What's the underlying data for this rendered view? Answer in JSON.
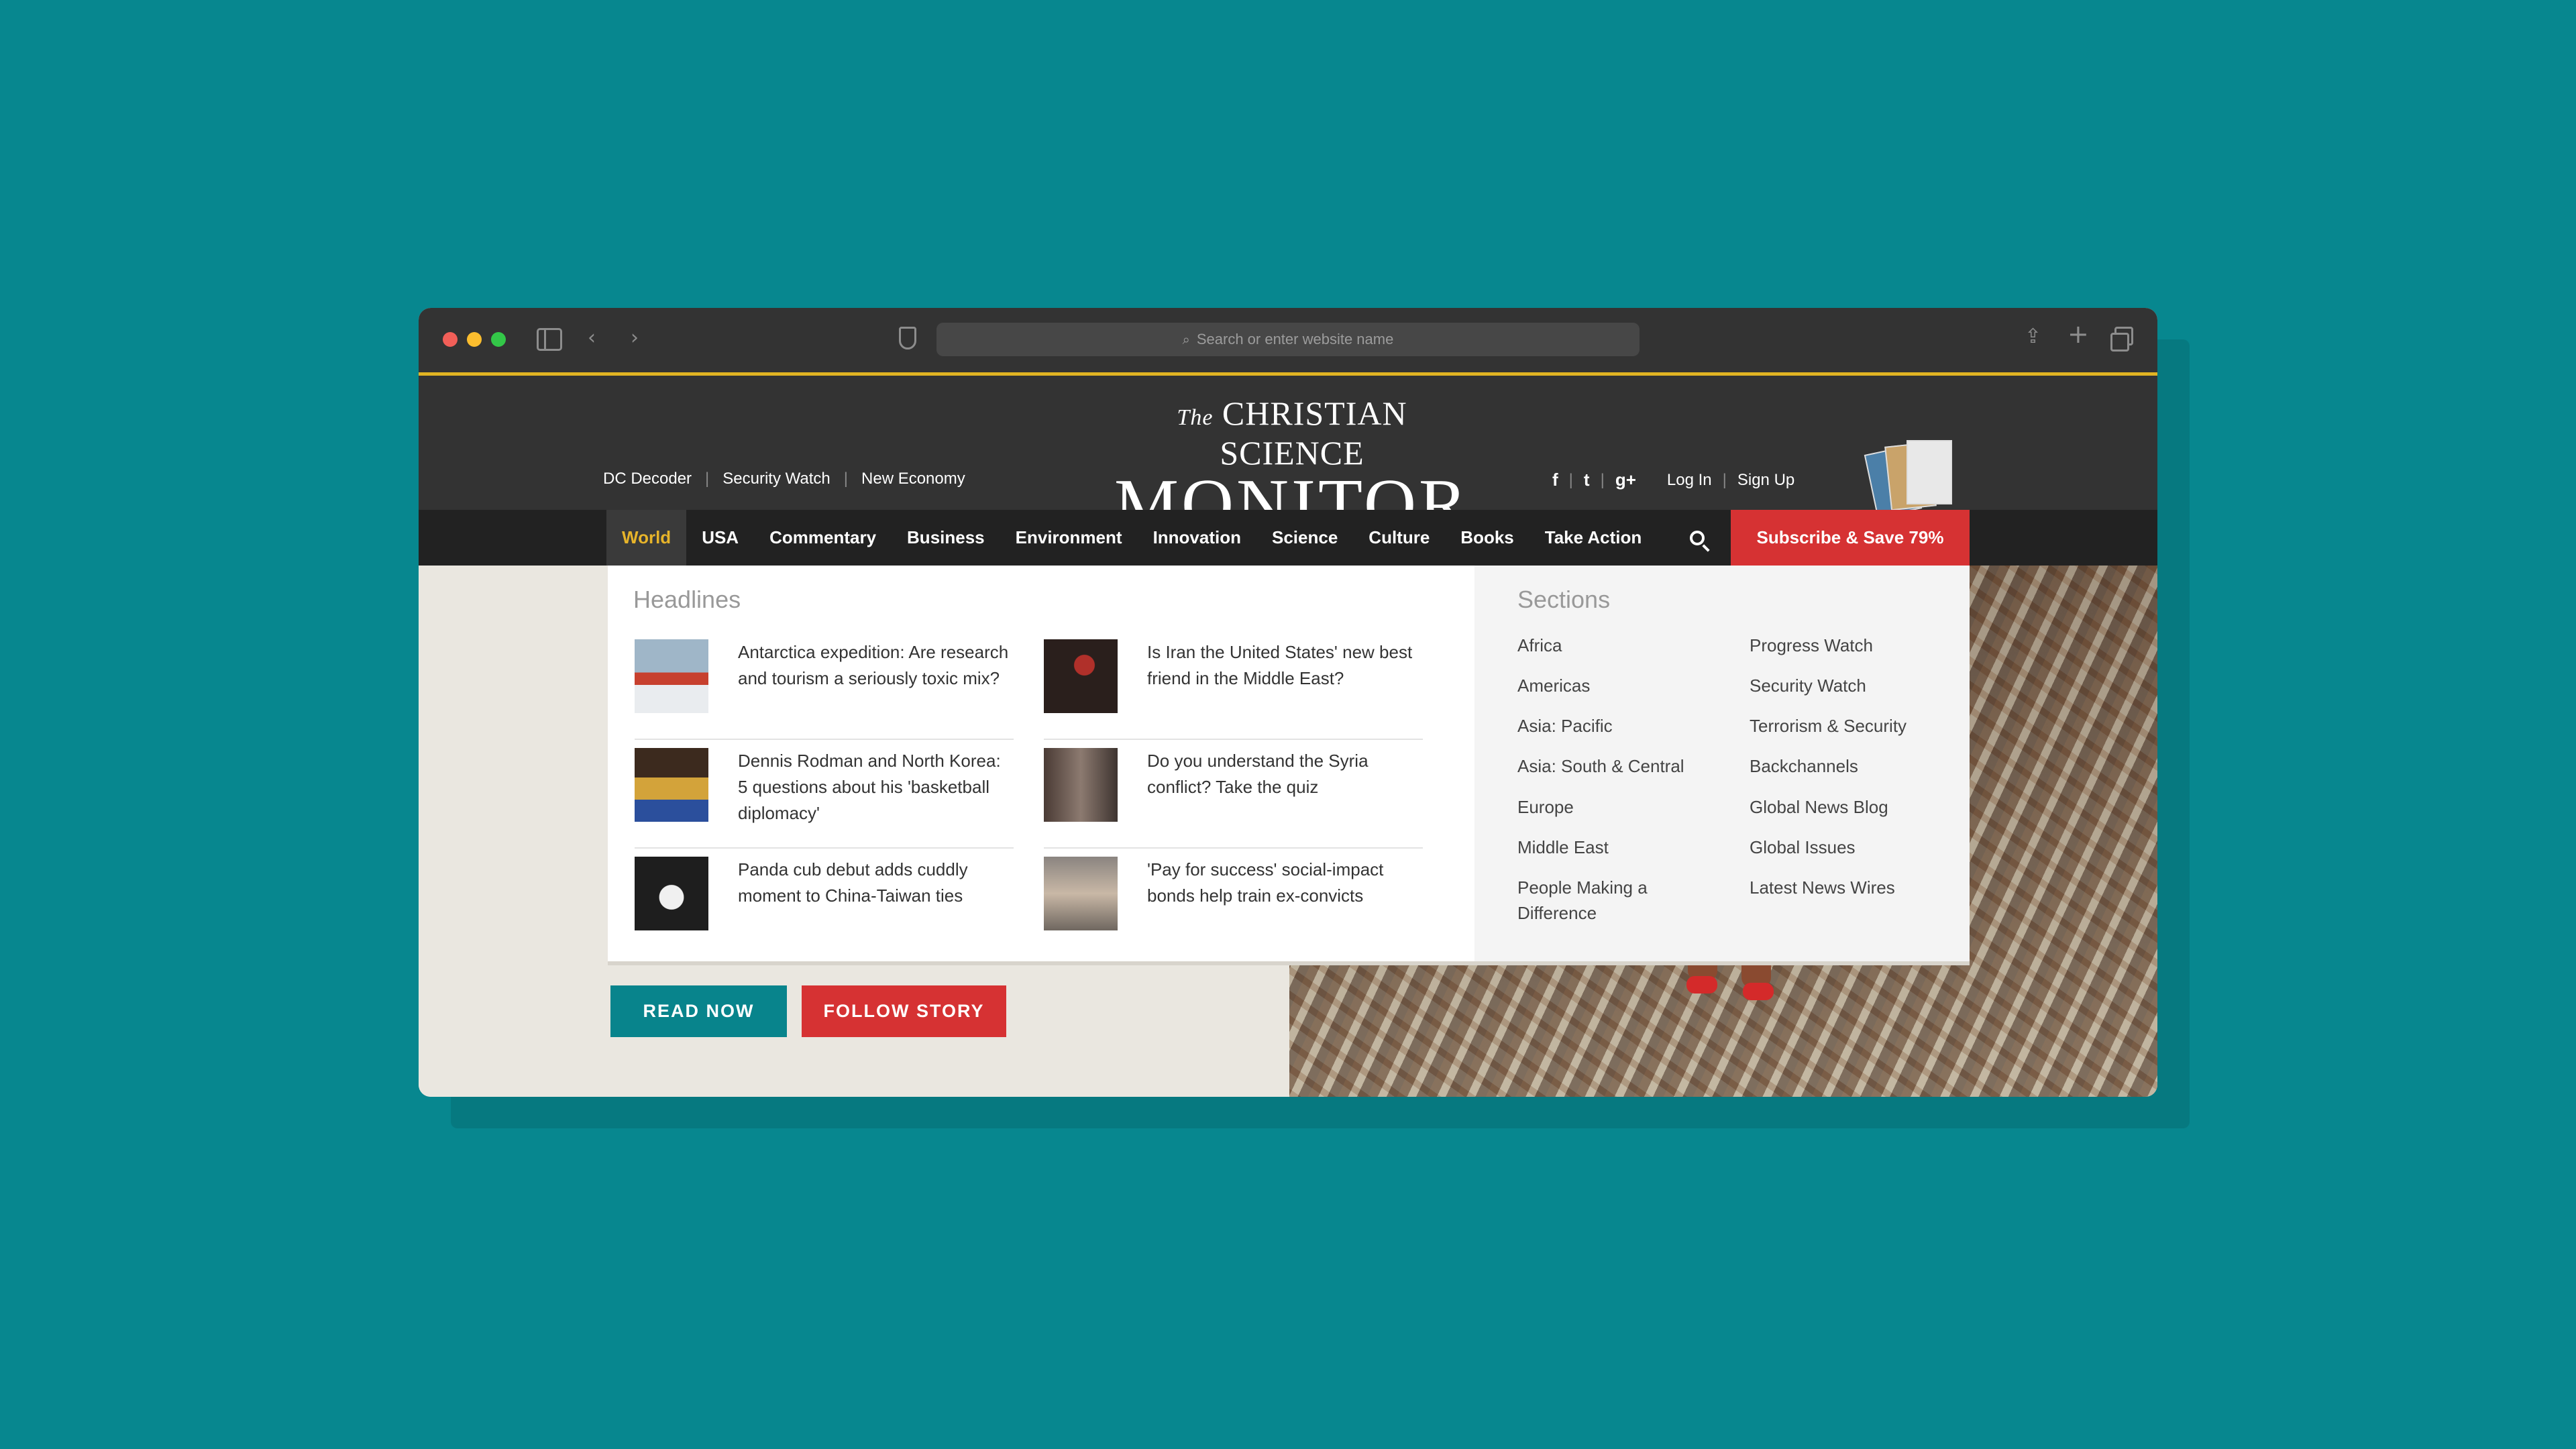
{
  "browser": {
    "url_placeholder": "Search or enter website name"
  },
  "site": {
    "logo_top_prefix": "The",
    "logo_top": "CHRISTIAN SCIENCE",
    "logo_main": "MONITOR",
    "top_links": [
      "DC Decoder",
      "Security Watch",
      "New Economy"
    ],
    "social": {
      "facebook": "f",
      "twitter": "t",
      "google_plus": "g+"
    },
    "account": {
      "login": "Log In",
      "signup": "Sign Up"
    }
  },
  "nav": {
    "items": [
      "World",
      "USA",
      "Commentary",
      "Business",
      "Environment",
      "Innovation",
      "Science",
      "Culture",
      "Books",
      "Take Action"
    ],
    "active": "World",
    "subscribe": "Subscribe & Save 79%"
  },
  "dropdown": {
    "headlines_title": "Headlines",
    "headlines": [
      "Antarctica expedition: Are research and tourism a seriously toxic mix?",
      "Is Iran the United States' new best friend in the Middle East?",
      "Dennis Rodman and North Korea: 5 questions about his 'basketball diplomacy'",
      "Do you understand the Syria conflict? Take the quiz",
      "Panda cub debut adds cuddly moment to China-Taiwan ties",
      "'Pay for success' social-impact bonds help train ex-convicts"
    ],
    "sections_title": "Sections",
    "sections_col1": [
      "Africa",
      "Americas",
      "Asia: Pacific",
      "Asia: South & Central",
      "Europe",
      "Middle East",
      "People Making a Difference"
    ],
    "sections_col2": [
      "Progress Watch",
      "Security Watch",
      "Terrorism & Security",
      "Backchannels",
      "Global News Blog",
      "Global Issues",
      "Latest News Wires"
    ]
  },
  "hero": {
    "read_now": "READ NOW",
    "follow_story": "FOLLOW STORY"
  },
  "colors": {
    "background": "#07878f",
    "accent_gold": "#e7b42a",
    "subscribe_red": "#d63233",
    "read_teal": "#08848c"
  }
}
